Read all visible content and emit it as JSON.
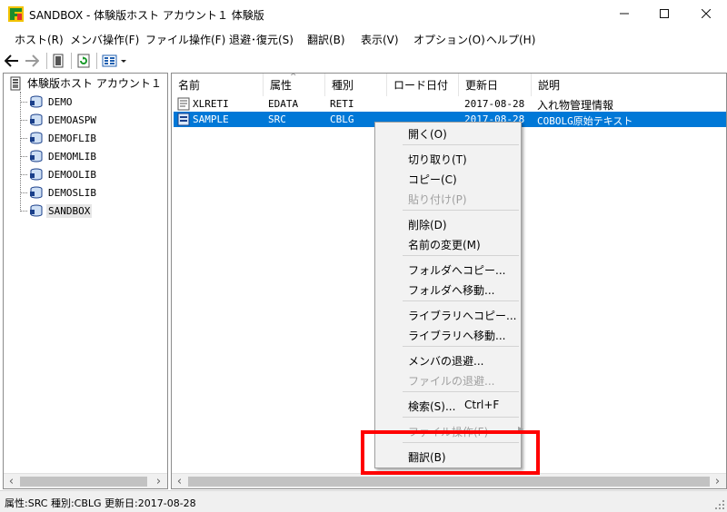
{
  "window": {
    "title": "SANDBOX - 体験版ホスト アカウント１ 体験版",
    "minimize_icon": "minimize-icon",
    "maximize_icon": "maximize-icon",
    "close_icon": "close-icon"
  },
  "menu": [
    "ホスト(R)",
    "メンバ操作(F)",
    "ファイル操作(F)",
    "退避･復元(S)",
    "翻訳(B)",
    "表示(V)",
    "オプション(O)",
    "ヘルプ(H)"
  ],
  "tree": {
    "root_label": "体験版ホスト アカウント１",
    "nodes": [
      "DEMO",
      "DEMOASPW",
      "DEMOFLIB",
      "DEMOMLIB",
      "DEMOOLIB",
      "DEMOSLIB",
      "SANDBOX"
    ],
    "selected": "SANDBOX"
  },
  "list": {
    "columns": [
      "名前",
      "属性",
      "種別",
      "ロード日付",
      "更新日",
      "説明"
    ],
    "rows": [
      {
        "name": "XLRETI",
        "attr": "EDATA",
        "type": "RETI",
        "load_date": "",
        "updated": "2017-08-28",
        "desc": "入れ物管理情報"
      },
      {
        "name": "SAMPLE",
        "attr": "SRC",
        "type": "CBLG",
        "load_date": "",
        "updated": "2017-08-28",
        "desc": "COBOLG原始テキスト"
      }
    ]
  },
  "context_menu": {
    "open": "開く(O)",
    "cut": "切り取り(T)",
    "copy": "コピー(C)",
    "paste": "貼り付け(P)",
    "delete": "削除(D)",
    "rename": "名前の変更(M)",
    "copy_to_folder": "フォルダへコピー...",
    "move_to_folder": "フォルダへ移動...",
    "copy_to_library": "ライブラリへコピー...",
    "move_to_library": "ライブラリへ移動...",
    "backup_member": "メンバの退避...",
    "backup_file": "ファイルの退避...",
    "search": "検索(S)...",
    "search_shortcut": "Ctrl+F",
    "file_operation": "ファイル操作(F)",
    "translate": "翻訳(B)"
  },
  "status": {
    "text": "属性:SRC 種別:CBLG 更新日:2017-08-28"
  },
  "colors": {
    "selection": "#0078d7",
    "highlight_box": "#ff0000",
    "disabled_text": "#a0a0a0"
  }
}
